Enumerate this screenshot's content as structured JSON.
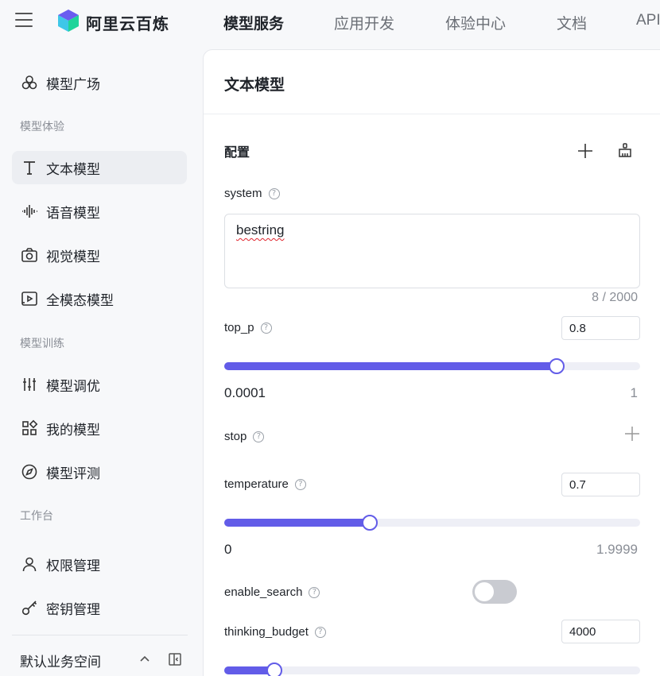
{
  "header": {
    "brand": "阿里云百炼",
    "nav": [
      "模型服务",
      "应用开发",
      "体验中心",
      "文档",
      "API"
    ]
  },
  "sidebar": {
    "top_item": "模型广场",
    "groups": {
      "experience": "模型体验",
      "training": "模型训练",
      "workbench": "工作台"
    },
    "items": {
      "text_model": "文本模型",
      "voice_model": "语音模型",
      "vision_model": "视觉模型",
      "omni_model": "全模态模型",
      "fine_tune": "模型调优",
      "my_models": "我的模型",
      "evaluation": "模型评测",
      "permissions": "权限管理",
      "keys": "密钥管理"
    },
    "workspace": "默认业务空间"
  },
  "panel": {
    "title": "文本模型",
    "section": "配置",
    "system": {
      "label": "system",
      "value": "bestring",
      "counter": "8 / 2000"
    },
    "top_p": {
      "label": "top_p",
      "value": "0.8",
      "min": "0.0001",
      "max": "1",
      "level": 0.8
    },
    "stop": {
      "label": "stop"
    },
    "temperature": {
      "label": "temperature",
      "value": "0.7",
      "min": "0",
      "max": "1.9999",
      "level": 0.35
    },
    "enable_search": {
      "label": "enable_search",
      "on": false
    },
    "thinking_budget": {
      "label": "thinking_budget",
      "value": "4000",
      "level": 0.12
    }
  },
  "colors": {
    "accent": "#625ce8",
    "sidebar_bg": "#f7f8fa",
    "active_item_bg": "#eceef2",
    "toggle_off": "#c9cbd1"
  },
  "icons": [
    "menu-icon",
    "logo-icon",
    "model-square-icon",
    "text-icon",
    "audio-wave-icon",
    "camera-icon",
    "video-play-icon",
    "sliders-icon",
    "grid-icon",
    "compass-icon",
    "user-icon",
    "key-icon",
    "chevron-up-icon",
    "sidebar-collapse-icon",
    "plus-icon",
    "broom-icon",
    "help-icon"
  ]
}
